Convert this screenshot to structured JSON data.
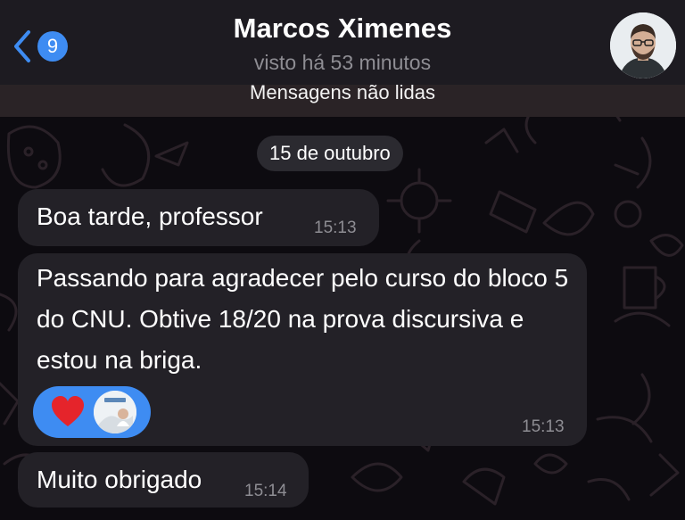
{
  "header": {
    "back_badge_count": "9",
    "contact_name": "Marcos Ximenes",
    "contact_status": "visto há 53 minutos"
  },
  "unread_banner": "Mensagens não lidas",
  "date_separator": "15 de outubro",
  "messages": [
    {
      "text": "Boa tarde, professor",
      "time": "15:13"
    },
    {
      "text": "Passando para agradecer pelo curso do bloco 5 do CNU. Obtive 18/20 na prova discursiva e estou na briga.",
      "time": "15:13",
      "reaction": "heart-icon"
    },
    {
      "text": "Muito obrigado",
      "time": "15:14"
    }
  ],
  "colors": {
    "accent": "#3e8cf2",
    "bubble": "#232127",
    "header": "#1d1b21",
    "background": "#0d0b10",
    "muted_text": "#8e8d93",
    "reaction_heart": "#e5242b"
  },
  "icons": {
    "back": "chevron-left-icon",
    "reaction": "heart-icon"
  }
}
